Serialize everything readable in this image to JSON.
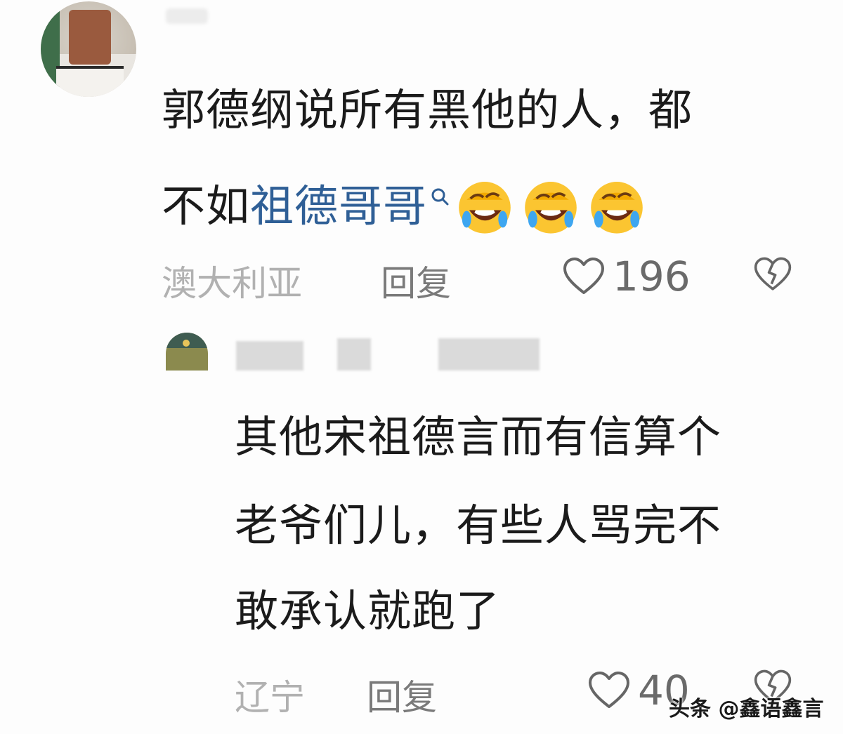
{
  "comments": [
    {
      "text_line1": "郭德纲说所有黑他的人，都",
      "text_line2_prefix": "不如",
      "link_text": "祖德哥哥",
      "emoji": [
        "laughing-tears-emoji",
        "laughing-tears-emoji",
        "laughing-tears-emoji"
      ],
      "location": "澳大利亚",
      "reply_label": "回复",
      "likes": "196"
    },
    {
      "text_line1": "其他宋祖德言而有信算个",
      "text_line2": "老爷们儿，有些人骂完不",
      "text_line3": "敢承认就跑了",
      "location": "辽宁",
      "reply_label": "回复",
      "likes": "40"
    }
  ],
  "watermark": "头条 @鑫语鑫言",
  "colors": {
    "link": "#2f5f96",
    "text": "#1b1b1b",
    "meta": "#a3a3a3"
  }
}
